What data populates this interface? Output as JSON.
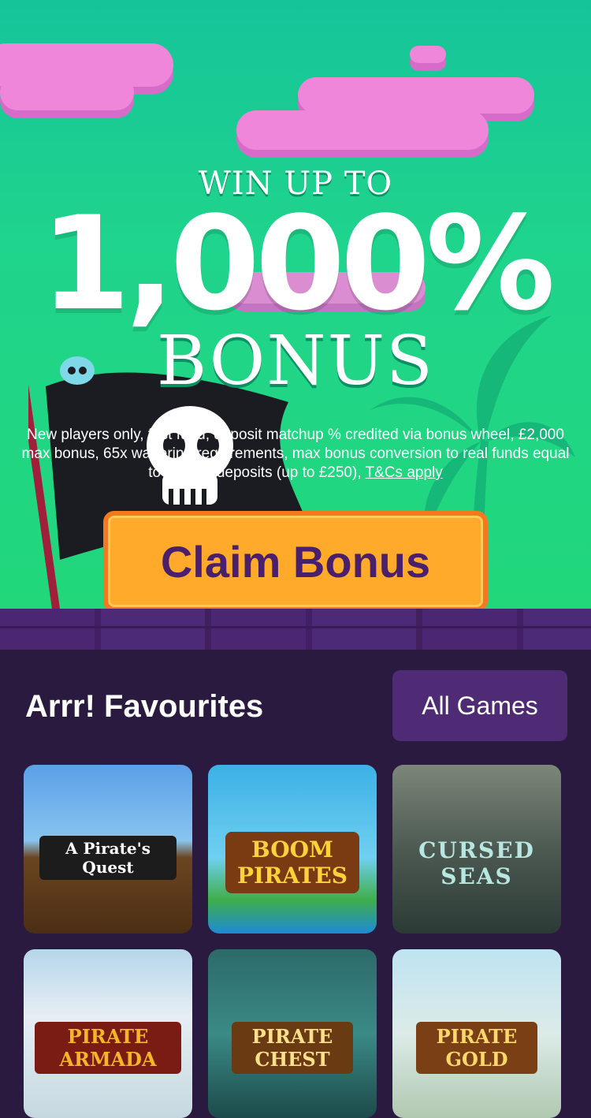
{
  "hero": {
    "win_up_to": "WIN UP TO",
    "percentage": "1,000%",
    "bonus_word": "BONUS",
    "terms_text": "New players only, first fund, deposit matchup % credited via bonus wheel, £2,000 max bonus, 65x wagering requirements, max bonus conversion to real funds equal to lifetime deposits (up to £250),",
    "terms_link": "T&Cs apply",
    "claim_button": "Claim Bonus"
  },
  "favourites": {
    "title": "Arrr! Favourites",
    "all_games_button": "All Games",
    "games": [
      {
        "name": "A Pirate's Quest"
      },
      {
        "name": "BOOM PIRATES"
      },
      {
        "name": "CURSED SEAS"
      },
      {
        "name": "PIRATE ARMADA"
      },
      {
        "name": "PIRATE CHEST"
      },
      {
        "name": "PIRATE GOLD"
      }
    ]
  },
  "colors": {
    "hero_green": "#1fd48c",
    "cloud_pink": "#ef86d9",
    "claim_orange": "#ffaa2a",
    "claim_text": "#4a1f6b",
    "section_bg": "#2b1a40",
    "button_purple": "#4e2b74"
  }
}
